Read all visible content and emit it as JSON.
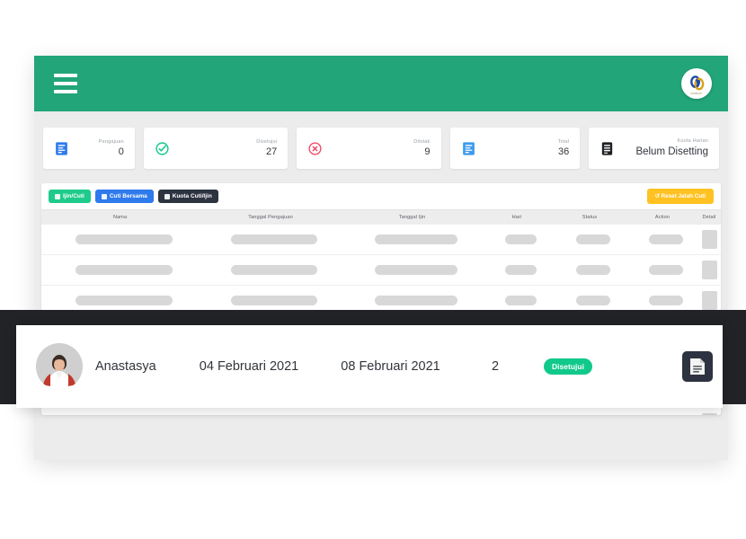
{
  "header": {
    "menu_icon": "hamburger-icon",
    "logo_icon": "company-logo-icon",
    "logo_caption": "COMPANY",
    "bar_color": "#22a578"
  },
  "stats": [
    {
      "icon": "document-icon",
      "icon_color": "#2f7aec",
      "label": "Pengajuan",
      "value": "0"
    },
    {
      "icon": "check-circle-icon",
      "icon_color": "#11c98a",
      "label": "Disetujui",
      "value": "27"
    },
    {
      "icon": "x-circle-icon",
      "icon_color": "#f0415f",
      "label": "Ditolak",
      "value": "9"
    },
    {
      "icon": "document-icon",
      "icon_color": "#3d9bea",
      "label": "Total",
      "value": "36"
    },
    {
      "icon": "document-dark-icon",
      "icon_color": "#1d1f23",
      "label": "Kuota Harian",
      "value": "Belum Disetting"
    }
  ],
  "tabs": [
    {
      "label": "Ijin/Cuti",
      "color": "#1ecb8b",
      "icon": "calendar-icon"
    },
    {
      "label": "Cuti Bersama",
      "color": "#2f7aec",
      "icon": "calendar-icon"
    },
    {
      "label": "Kuota Cuti/Ijin",
      "color": "#2d3340",
      "icon": "calendar-icon"
    }
  ],
  "reset_button": {
    "label": "Reset Jatah Cuti",
    "icon": "refresh-icon",
    "color": "#ffc222"
  },
  "table": {
    "columns": [
      "Nama",
      "Tanggal Pengajuan",
      "Tanggal Ijin",
      "Hari",
      "Status",
      "Action",
      "Detail"
    ],
    "placeholder_rows": 7
  },
  "highlighted_row": {
    "avatar": "user-avatar",
    "nama": "Anastasya",
    "tanggal_pengajuan": "04 Februari 2021",
    "tanggal_ijin": "08 Februari 2021",
    "hari": "2",
    "status": "Disetujui",
    "status_color": "#11c98a",
    "detail_icon": "document-detail-icon"
  }
}
